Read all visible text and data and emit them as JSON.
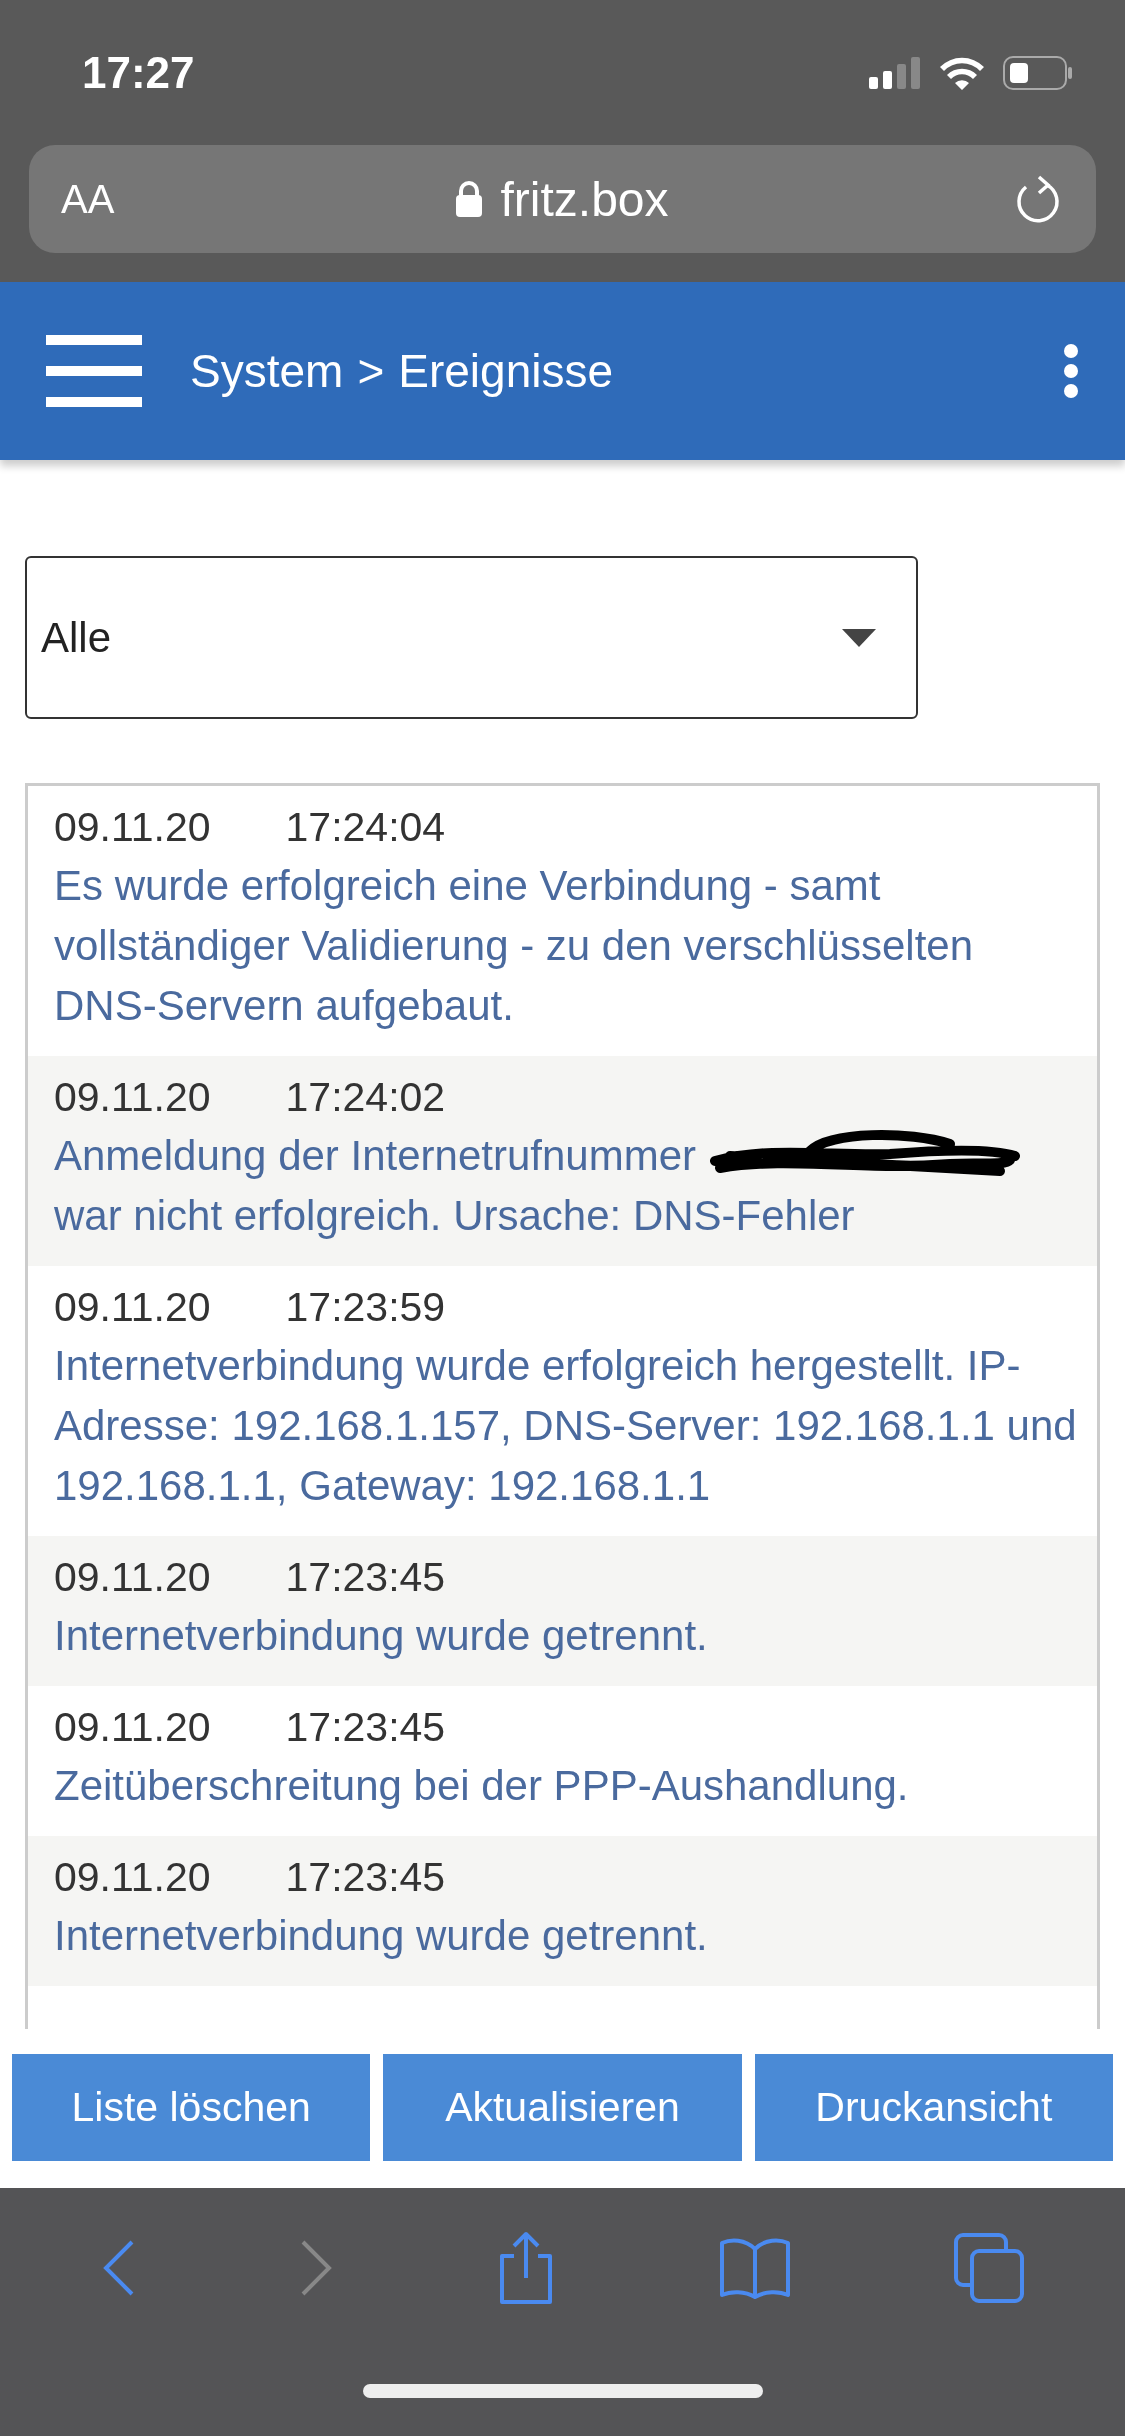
{
  "status_bar": {
    "time": "17:27"
  },
  "browser": {
    "text_size": "AA",
    "url": "fritz.box"
  },
  "header": {
    "section": "System",
    "separator": ">",
    "page": "Ereignisse"
  },
  "filter": {
    "value": "Alle"
  },
  "events": [
    {
      "date": "09.11.20",
      "time": "17:24:04",
      "message": "Es wurde erfolgreich eine Verbindung - samt vollständiger Validierung - zu den verschlüsselten DNS-Servern aufgebaut.",
      "redacted": false
    },
    {
      "date": "09.11.20",
      "time": "17:24:02",
      "message": "Anmeldung der Internetrufnummer",
      "redacted": true,
      "message_after": "war nicht erfolgreich. Ursache: DNS-Fehler"
    },
    {
      "date": "09.11.20",
      "time": "17:23:59",
      "message": "Internetverbindung wurde erfolgreich hergestellt. IP-Adresse: 192.168.1.157, DNS-Server: 192.168.1.1 und 192.168.1.1, Gateway: 192.168.1.1",
      "redacted": false
    },
    {
      "date": "09.11.20",
      "time": "17:23:45",
      "message": "Internetverbindung wurde getrennt.",
      "redacted": false
    },
    {
      "date": "09.11.20",
      "time": "17:23:45",
      "message": "Zeitüberschreitung bei der PPP-Aushandlung.",
      "redacted": false
    },
    {
      "date": "09.11.20",
      "time": "17:23:45",
      "message": "Internetverbindung wurde getrennt.",
      "redacted": false
    }
  ],
  "buttons": [
    "Liste löschen",
    "Aktualisieren",
    "Druckansicht"
  ],
  "toolbar": {
    "forward_disabled": true
  }
}
